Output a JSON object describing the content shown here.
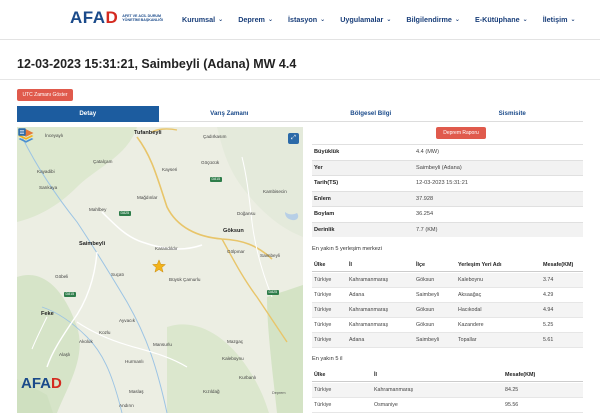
{
  "header": {
    "logo_main": "AFAD",
    "logo_sub": "AFET VE ACİL DURUM YÖNETİMİ BAŞKANLIĞI",
    "nav": [
      {
        "label": "Kurumsal"
      },
      {
        "label": "Deprem"
      },
      {
        "label": "İstasyon"
      },
      {
        "label": "Uygulamalar"
      },
      {
        "label": "Bilgilendirme"
      },
      {
        "label": "E-Kütüphane"
      },
      {
        "label": "İletişim"
      }
    ]
  },
  "page_title": "12-03-2023 15:31:21, Saimbeyli (Adana) MW 4.4",
  "utc_button": "UTC Zamanı Göster",
  "tabs": [
    {
      "label": "Detay",
      "active": true
    },
    {
      "label": "Varış Zamanı",
      "active": false
    },
    {
      "label": "Bölgesel Bilgi",
      "active": false
    },
    {
      "label": "Sismisite",
      "active": false
    }
  ],
  "map": {
    "labels": [
      {
        "text": "İnceyaylı"
      },
      {
        "text": "Tufanbeyli"
      },
      {
        "text": "Çadırkasım"
      },
      {
        "text": "Çatalçam"
      },
      {
        "text": "Göçücük"
      },
      {
        "text": "Kayadibi"
      },
      {
        "text": "Kayseri"
      },
      {
        "text": "Sarıkaya"
      },
      {
        "text": "Mağdınlar"
      },
      {
        "text": "Kambisecin"
      },
      {
        "text": "Mahlbey"
      },
      {
        "text": "Doğansu"
      },
      {
        "text": "Göksun"
      },
      {
        "text": "Saimbeyli"
      },
      {
        "text": "Karandıldır"
      },
      {
        "text": "Göbeli"
      },
      {
        "text": "Suçatı"
      },
      {
        "text": "Gölpınar"
      },
      {
        "text": "Saimbeyli"
      },
      {
        "text": "Feke"
      },
      {
        "text": "Büyük Çamurlu"
      },
      {
        "text": "Ayvacık"
      },
      {
        "text": "Kozlu"
      },
      {
        "text": "Mansurlu"
      },
      {
        "text": "Akoluk"
      },
      {
        "text": "Alaşlı"
      },
      {
        "text": "Mazgaç"
      },
      {
        "text": "Kaleboynu"
      },
      {
        "text": "Hurmanlı"
      },
      {
        "text": "Kurbanlı"
      },
      {
        "text": "Kızıldağ"
      },
      {
        "text": "Maslaş"
      },
      {
        "text": "Andırın"
      }
    ],
    "roads": [
      "D815",
      "D825",
      "D825",
      "D815"
    ],
    "watermark": "AFAD",
    "attribution": "Deprem"
  },
  "report_button": "Deprem Raporu",
  "info": [
    {
      "key": "Büyüklük",
      "value": "4.4 (MW)"
    },
    {
      "key": "Yer",
      "value": "Saimbeyli (Adana)"
    },
    {
      "key": "Tarih(TS)",
      "value": "12-03-2023 15:31:21"
    },
    {
      "key": "Enlem",
      "value": "37.928"
    },
    {
      "key": "Boylam",
      "value": "36.254"
    },
    {
      "key": "Derinlik",
      "value": "7.7 (KM)"
    }
  ],
  "settlements": {
    "heading": "En yakın 5 yerleşim merkezi",
    "columns": [
      "Ülke",
      "İl",
      "İlçe",
      "Yerleşim Yeri Adı",
      "Mesafe(KM)"
    ],
    "rows": [
      [
        "Türkiye",
        "Kahramanmaraş",
        "Göksun",
        "Kaleboynu",
        "3.74"
      ],
      [
        "Türkiye",
        "Adana",
        "Saimbeyli",
        "Aksaağaç",
        "4.29"
      ],
      [
        "Türkiye",
        "Kahramanmaraş",
        "Göksun",
        "Hacıkodal",
        "4.94"
      ],
      [
        "Türkiye",
        "Kahramanmaraş",
        "Göksun",
        "Kazandere",
        "5.25"
      ],
      [
        "Türkiye",
        "Adana",
        "Saimbeyli",
        "Topallar",
        "5.61"
      ]
    ]
  },
  "provinces": {
    "heading": "En yakın 5 il",
    "columns": [
      "Ülke",
      "İl",
      "Mesafe(KM)"
    ],
    "rows": [
      [
        "Türkiye",
        "Kahramanmaraş",
        "84.25"
      ],
      [
        "Türkiye",
        "Osmaniye",
        "95.56"
      ]
    ]
  }
}
